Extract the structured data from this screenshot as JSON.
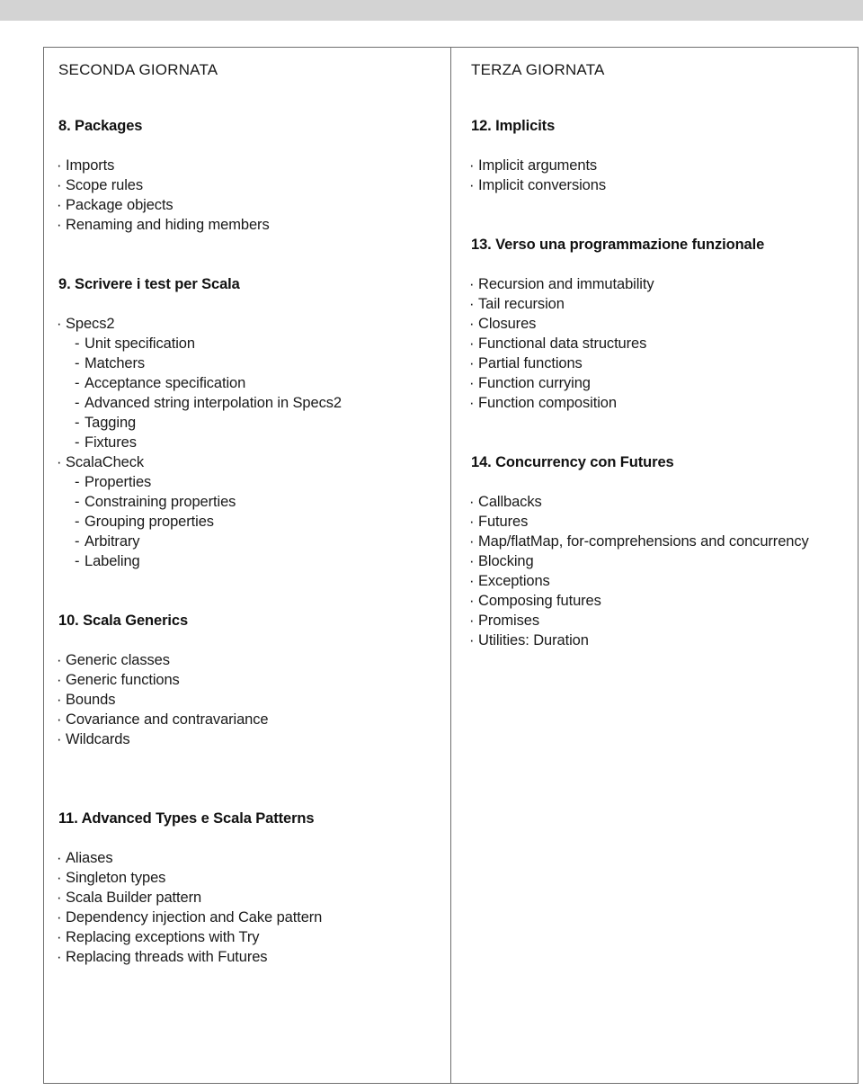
{
  "page": {
    "top_band_color": "#d3d3d3",
    "border_color": "#6f6f6f",
    "text_color": "#1a1a1a"
  },
  "columns": {
    "left": {
      "day_title": "SECONDA GIORNATA",
      "sections": [
        {
          "heading": "8. Packages",
          "items": [
            {
              "level": 1,
              "text": "Imports"
            },
            {
              "level": 1,
              "text": "Scope rules"
            },
            {
              "level": 1,
              "text": "Package objects"
            },
            {
              "level": 1,
              "text": "Renaming and hiding members"
            }
          ]
        },
        {
          "heading": "9. Scrivere i test per Scala",
          "items": [
            {
              "level": 1,
              "text": "Specs2"
            },
            {
              "level": 2,
              "text": "Unit specification"
            },
            {
              "level": 2,
              "text": "Matchers"
            },
            {
              "level": 2,
              "text": "Acceptance specification"
            },
            {
              "level": 2,
              "text": "Advanced string interpolation in Specs2"
            },
            {
              "level": 2,
              "text": "Tagging"
            },
            {
              "level": 2,
              "text": "Fixtures"
            },
            {
              "level": 1,
              "text": "ScalaCheck"
            },
            {
              "level": 2,
              "text": "Properties"
            },
            {
              "level": 2,
              "text": "Constraining properties"
            },
            {
              "level": 2,
              "text": "Grouping properties"
            },
            {
              "level": 2,
              "text": "Arbitrary"
            },
            {
              "level": 2,
              "text": "Labeling"
            }
          ]
        },
        {
          "heading": "10. Scala Generics",
          "items": [
            {
              "level": 1,
              "text": "Generic classes"
            },
            {
              "level": 1,
              "text": "Generic functions"
            },
            {
              "level": 1,
              "text": "Bounds"
            },
            {
              "level": 1,
              "text": "Covariance and contravariance"
            },
            {
              "level": 1,
              "text": "Wildcards"
            }
          ]
        },
        {
          "heading": "11. Advanced Types e Scala Patterns",
          "items": [
            {
              "level": 1,
              "text": "Aliases"
            },
            {
              "level": 1,
              "text": "Singleton types"
            },
            {
              "level": 1,
              "text": "Scala Builder pattern"
            },
            {
              "level": 1,
              "text": "Dependency injection and Cake pattern"
            },
            {
              "level": 1,
              "text": "Replacing exceptions with Try"
            },
            {
              "level": 1,
              "text": "Replacing threads with Futures"
            }
          ]
        }
      ]
    },
    "right": {
      "day_title": "TERZA GIORNATA",
      "sections": [
        {
          "heading": "12. Implicits",
          "items": [
            {
              "level": 1,
              "text": "Implicit arguments"
            },
            {
              "level": 1,
              "text": "Implicit conversions"
            }
          ]
        },
        {
          "heading": "13. Verso una programmazione funzionale",
          "items": [
            {
              "level": 1,
              "text": "Recursion and immutability"
            },
            {
              "level": 1,
              "text": "Tail recursion"
            },
            {
              "level": 1,
              "text": "Closures"
            },
            {
              "level": 1,
              "text": "Functional data structures"
            },
            {
              "level": 1,
              "text": "Partial functions"
            },
            {
              "level": 1,
              "text": "Function currying"
            },
            {
              "level": 1,
              "text": "Function composition"
            }
          ]
        },
        {
          "heading": "14. Concurrency con Futures",
          "items": [
            {
              "level": 1,
              "text": "Callbacks"
            },
            {
              "level": 1,
              "text": "Futures"
            },
            {
              "level": 1,
              "text": "Map/flatMap, for-comprehensions and concurrency"
            },
            {
              "level": 1,
              "text": "Blocking"
            },
            {
              "level": 1,
              "text": "Exceptions"
            },
            {
              "level": 1,
              "text": "Composing futures"
            },
            {
              "level": 1,
              "text": "Promises"
            },
            {
              "level": 1,
              "text": "Utilities: Duration"
            }
          ]
        }
      ]
    }
  }
}
